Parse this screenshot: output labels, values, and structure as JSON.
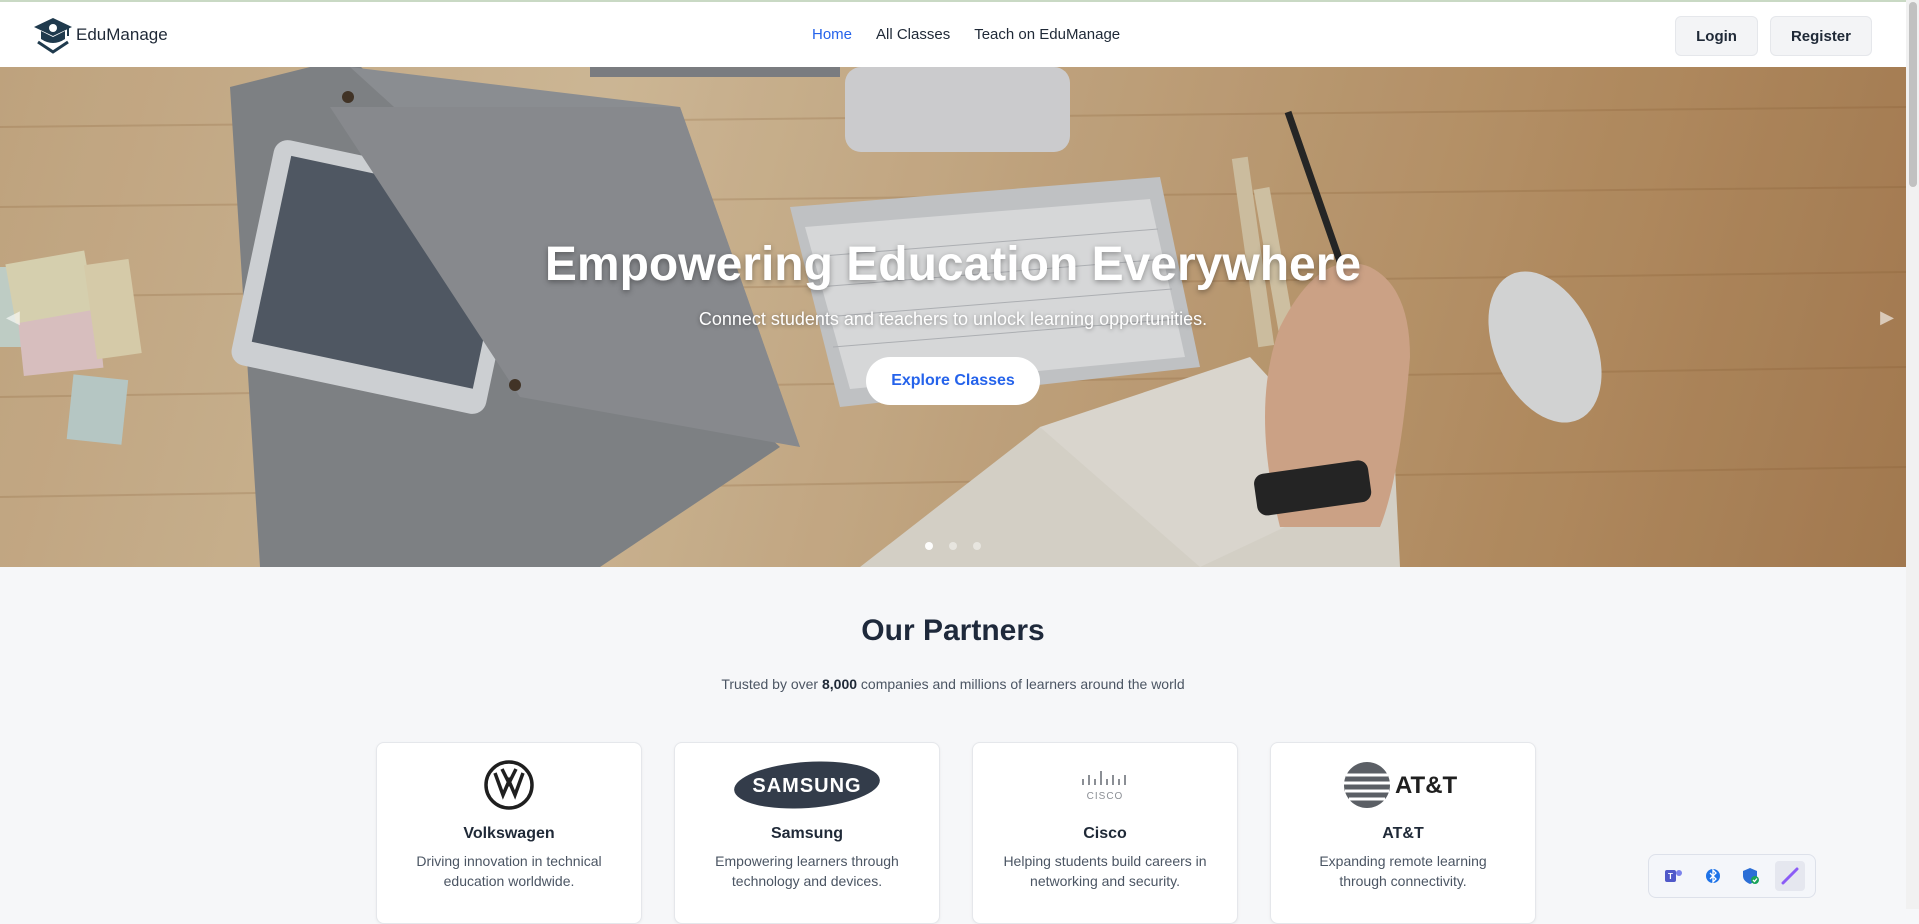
{
  "brand": {
    "name": "EduManage"
  },
  "nav": {
    "items": [
      "Home",
      "All Classes",
      "Teach on EduManage"
    ],
    "active": "Home"
  },
  "auth": {
    "login": "Login",
    "register": "Register"
  },
  "hero": {
    "title": "Empowering Education Everywhere",
    "subtitle": "Connect students and teachers to unlock learning opportunities.",
    "cta": "Explore Classes",
    "slides": {
      "count": 3,
      "active": 1
    }
  },
  "partners": {
    "title": "Our Partners",
    "subtitle_pre": "Trusted by over ",
    "subtitle_count": "8,000",
    "subtitle_post": " companies and millions of learners around the world",
    "cards": [
      {
        "name": "Volkswagen",
        "desc": "Driving innovation in technical education worldwide.",
        "icon": "volkswagen-logo"
      },
      {
        "name": "Samsung",
        "desc": "Empowering learners through technology and devices.",
        "icon": "samsung-logo",
        "logo_text": "SAMSUNG"
      },
      {
        "name": "Cisco",
        "desc": "Helping students build careers in networking and security.",
        "icon": "cisco-logo",
        "logo_text": "CISCO"
      },
      {
        "name": "AT&T",
        "desc": "Expanding remote learning through connectivity.",
        "icon": "att-logo",
        "logo_text": "AT&T"
      }
    ]
  },
  "tray": {
    "icons": [
      "teams-icon",
      "bluetooth-icon",
      "security-shield-icon",
      "pen-icon"
    ]
  },
  "colors": {
    "accent": "#2563eb",
    "heading": "#1e293b",
    "text_muted": "#4b5563"
  }
}
